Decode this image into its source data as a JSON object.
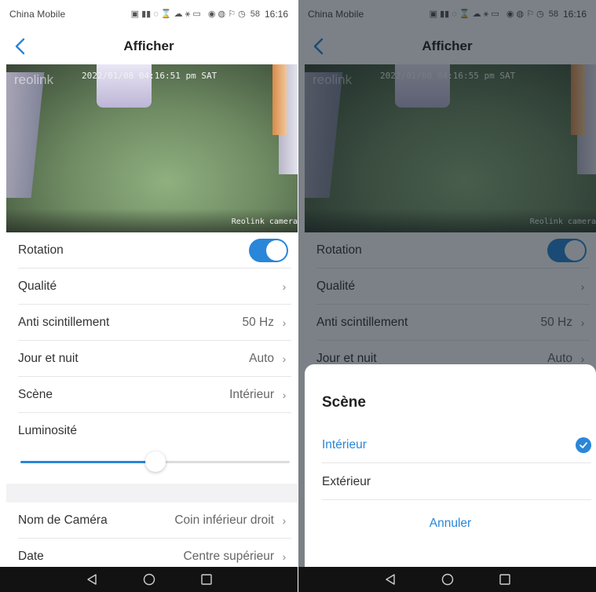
{
  "status_bar": {
    "left": {
      "carrier": "China Mobile",
      "time": "16:16",
      "battery": "58"
    },
    "right": {
      "carrier": "China Mobile",
      "time": "16:16",
      "battery": "58"
    }
  },
  "header": {
    "title": "Afficher"
  },
  "camera_left": {
    "logo": "reolink",
    "timestamp": "2022/01/08 04:16:51 pm SAT",
    "watermark": "Reolink camera"
  },
  "camera_right": {
    "logo": "reolink",
    "timestamp": "2022/01/08 04:16:55 pm SAT",
    "watermark": "Reolink camera"
  },
  "settings": {
    "rotation": {
      "label": "Rotation",
      "enabled": true
    },
    "quality": {
      "label": "Qualité"
    },
    "anti_flicker": {
      "label": "Anti scintillement",
      "value": "50 Hz"
    },
    "day_night": {
      "label": "Jour et nuit",
      "value": "Auto"
    },
    "scene": {
      "label": "Scène",
      "value": "Intérieur"
    },
    "brightness": {
      "label": "Luminosité",
      "level": 0.5
    },
    "camera_name": {
      "label": "Nom de Caméra",
      "value": "Coin inférieur droit"
    },
    "date": {
      "label": "Date",
      "value": "Centre supérieur"
    }
  },
  "scene_sheet": {
    "title": "Scène",
    "options": [
      {
        "label": "Intérieur",
        "selected": true
      },
      {
        "label": "Extérieur",
        "selected": false
      }
    ],
    "cancel_label": "Annuler"
  },
  "colors": {
    "accent": "#2a86d8",
    "navbar": "#121212",
    "divider": "#e6e6e6"
  },
  "icons": {
    "back": "chevron-left-icon",
    "row_arrow": "chevron-right-icon",
    "nav_back": "triangle-back-icon",
    "nav_home": "circle-home-icon",
    "nav_recent": "square-recent-icon",
    "selected": "check-circle-icon"
  }
}
